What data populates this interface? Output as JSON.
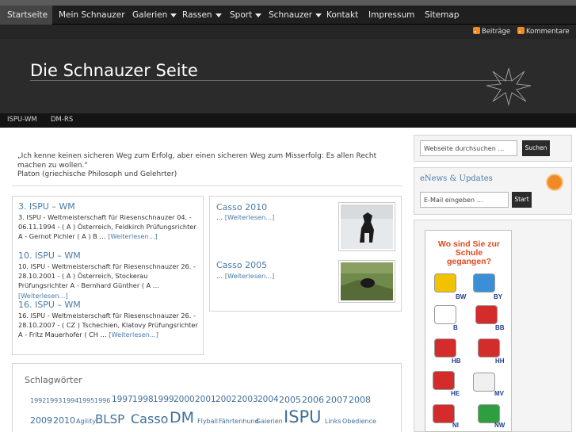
{
  "nav": {
    "items": [
      {
        "label": "Startseite",
        "active": true,
        "dropdown": false
      },
      {
        "label": "Mein Schnauzer",
        "active": false,
        "dropdown": false
      },
      {
        "label": "Galerien",
        "active": false,
        "dropdown": true
      },
      {
        "label": "Rassen",
        "active": false,
        "dropdown": true
      },
      {
        "label": "Sport",
        "active": false,
        "dropdown": true
      },
      {
        "label": "Schnauzer",
        "active": false,
        "dropdown": true
      },
      {
        "label": "Kontakt",
        "active": false,
        "dropdown": false
      },
      {
        "label": "Impressum",
        "active": false,
        "dropdown": false
      },
      {
        "label": "Sitemap",
        "active": false,
        "dropdown": false
      }
    ]
  },
  "feeds": {
    "posts": "Beiträge",
    "comments": "Kommentare"
  },
  "header": {
    "title": "Die Schnauzer Seite"
  },
  "subnav": {
    "items": [
      "ISPU-WM",
      "DM-RS"
    ]
  },
  "quote": {
    "text": "„Ich kenne keinen sicheren Weg zum Erfolg, aber einen sicheren Weg zum Misserfolg: Es allen Recht machen zu wollen.“",
    "author": "Platon (griechische Philosoph und Gelehrter)"
  },
  "posts": [
    {
      "title": "3. ISPU – WM",
      "text": "3. ISPU - Weltmeisterschaft für Riesenschnauzer 04. - 06.11.1994 - ( A ) Österreich, Feldkirch Prüfungsrichter A - Gernot Pichler ( A )   B …",
      "more": "[Weiterlesen...]"
    },
    {
      "title": "10. ISPU – WM",
      "text": "10. ISPU - Weltmeisterschaft für Riesenschnauzer 26. - 28.10.2001 - ( A ) Österreich, Stockerau Prüfungsrichter A - Bernhard Günther ( A …",
      "more": "[Weiterlesen...]"
    },
    {
      "title": "16. ISPU – WM",
      "text": "16. ISPU - Weltmeisterschaft für Riesenschnauzer 26. - 28.10.2007 - ( CZ ) Tschechien, Klatovy Prüfungsrichter A - Fritz Mauerhofer ( CH …",
      "more": "[Weiterlesen...]"
    }
  ],
  "side_posts": [
    {
      "title": "Casso 2010",
      "text": "…",
      "more": "[Weiterlesen...]"
    },
    {
      "title": "Casso 2005",
      "text": "…",
      "more": "[Weiterlesen...]"
    }
  ],
  "tags": {
    "title": "Schlagwörter",
    "items": [
      "1992",
      "1993",
      "1994",
      "1995",
      "1996",
      "1997",
      "1998",
      "1999",
      "2000",
      "2001",
      "2002",
      "2003",
      "2004",
      "2005",
      "2006",
      "2007",
      "2008",
      "2009",
      "2010",
      "Agility",
      "BLSP",
      "Casso",
      "DM",
      "Flyball",
      "Fährtenhund",
      "Galerien",
      "ISPU",
      "Links",
      "Obedience"
    ]
  },
  "sidebar": {
    "search_placeholder": "Webseite durchsuchen …",
    "search_button": "Suchen",
    "enews_title": "eNews & Updates",
    "email_placeholder": "E-Mail eingeben …",
    "email_button": "Start"
  },
  "map_widget": {
    "heading": "Wo sind Sie zur Schule gegangen?",
    "states": [
      "BW",
      "BY",
      "B",
      "BB",
      "HB",
      "HH",
      "HE",
      "MV",
      "NI",
      "NW"
    ],
    "crest_colors": [
      "#f2c100",
      "#3a8fd6",
      "#ffffff",
      "#d42b2b",
      "#d42b2b",
      "#d42b2b",
      "#d42b2b",
      "#f0f0f0",
      "#d42b2b",
      "#2f9e41"
    ]
  }
}
